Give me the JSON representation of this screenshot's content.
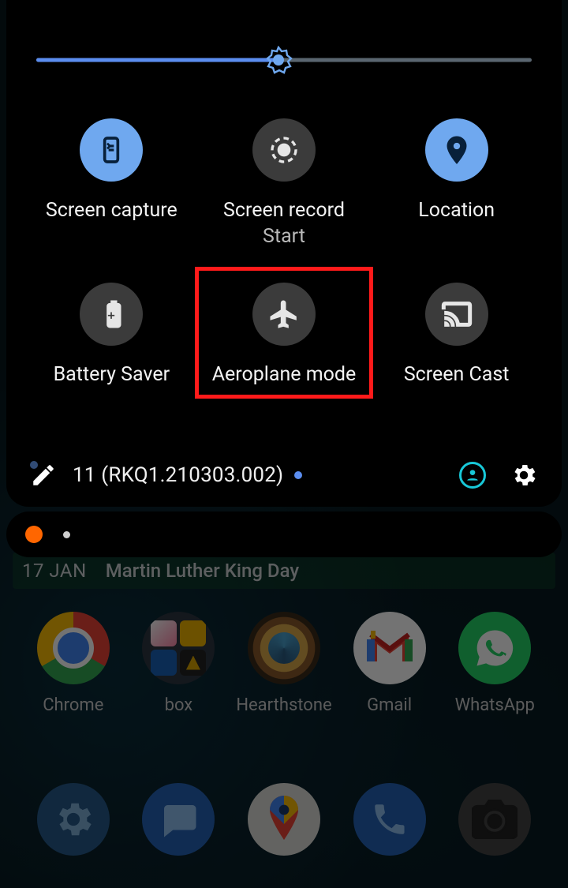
{
  "brightness": {
    "percent": 49
  },
  "tiles": [
    {
      "id": "screen-capture",
      "label": "Screen capture",
      "sub": "",
      "on": true
    },
    {
      "id": "screen-record",
      "label": "Screen record",
      "sub": "Start",
      "on": false
    },
    {
      "id": "location",
      "label": "Location",
      "sub": "",
      "on": true
    },
    {
      "id": "battery-saver",
      "label": "Battery Saver",
      "sub": "",
      "on": false
    },
    {
      "id": "aeroplane-mode",
      "label": "Aeroplane mode",
      "sub": "",
      "on": false,
      "highlighted": true
    },
    {
      "id": "screen-cast",
      "label": "Screen Cast",
      "sub": "",
      "on": false
    }
  ],
  "version": "11 (RKQ1.210303.002)",
  "calendar": {
    "date": "17 JAN",
    "event": "Martin Luther King Day"
  },
  "apps": [
    {
      "id": "chrome",
      "label": "Chrome"
    },
    {
      "id": "box",
      "label": "box"
    },
    {
      "id": "hearthstone",
      "label": "Hearthstone"
    },
    {
      "id": "gmail",
      "label": "Gmail"
    },
    {
      "id": "whatsapp",
      "label": "WhatsApp"
    }
  ],
  "dock": [
    {
      "id": "settings"
    },
    {
      "id": "messages"
    },
    {
      "id": "maps"
    },
    {
      "id": "phone"
    },
    {
      "id": "camera"
    }
  ]
}
